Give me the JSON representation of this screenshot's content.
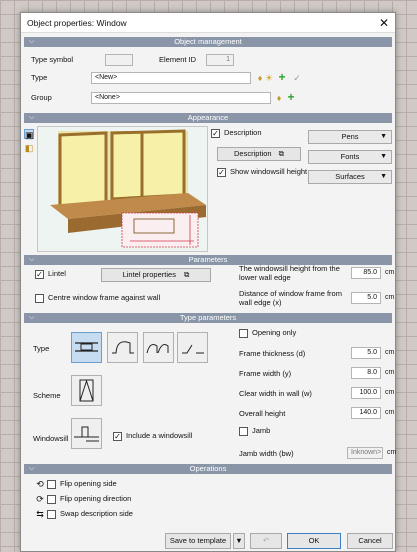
{
  "dialog": {
    "title": "Object properties: Window",
    "close_glyph": "✕"
  },
  "sections": {
    "object_management": "Object management",
    "appearance": "Appearance",
    "parameters": "Parameters",
    "type_parameters": "Type parameters",
    "operations": "Operations"
  },
  "object_management": {
    "type_symbol_label": "Type symbol",
    "element_id_label": "Element ID",
    "element_id_value": "1",
    "type_label": "Type",
    "type_value": "<New>",
    "group_label": "Group",
    "group_value": "<None>"
  },
  "appearance": {
    "description_label": "Description",
    "description_button": "Description",
    "show_windowsill_label": "Show windowsill height",
    "pens": "Pens",
    "fonts": "Fonts",
    "surfaces": "Surfaces"
  },
  "parameters": {
    "lintel_label": "Lintel",
    "lintel_properties_button": "Lintel properties",
    "centre_label": "Centre window frame against wall",
    "sill_height_label": "The windowsill height from the lower wall edge",
    "sill_height_value": "85.0",
    "distance_label": "Distance of window frame from wall edge (x)",
    "distance_value": "5.0",
    "unit": "cm"
  },
  "type_parameters": {
    "type_label": "Type",
    "scheme_label": "Scheme",
    "windowsill_label": "Windowsill",
    "include_windowsill_label": "Include a windowsill",
    "opening_only_label": "Opening only",
    "frame_thickness_label": "Frame thickness (d)",
    "frame_thickness_value": "5.0",
    "frame_width_label": "Frame width (y)",
    "frame_width_value": "8.0",
    "clear_width_label": "Clear width in wall (w)",
    "clear_width_value": "100.0",
    "overall_height_label": "Overall height",
    "overall_height_value": "140.0",
    "jamb_label": "Jamb",
    "jamb_width_label": "Jamb width (bw)",
    "jamb_width_value": "Inknown>",
    "unit": "cm"
  },
  "operations": {
    "flip_side": "Flip opening side",
    "flip_direction": "Flip opening direction",
    "swap_description": "Swap description side"
  },
  "footer": {
    "save_template": "Save to template",
    "ok": "OK",
    "cancel": "Cancel"
  }
}
